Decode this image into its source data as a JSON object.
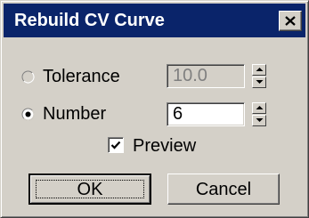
{
  "window": {
    "title": "Rebuild CV Curve"
  },
  "tolerance": {
    "label": "Tolerance",
    "value": "10.0",
    "selected": false,
    "enabled": false
  },
  "number": {
    "label": "Number",
    "value": "6",
    "selected": true
  },
  "preview": {
    "label": "Preview",
    "checked": true
  },
  "buttons": {
    "ok": "OK",
    "cancel": "Cancel"
  },
  "icons": {
    "close": "close-icon",
    "spin_up": "arrow-up-icon",
    "spin_down": "arrow-down-icon",
    "check": "check-icon"
  },
  "colors": {
    "titlebar": "#0a246a",
    "face": "#d4d0c8",
    "disabled_text": "#808080"
  }
}
